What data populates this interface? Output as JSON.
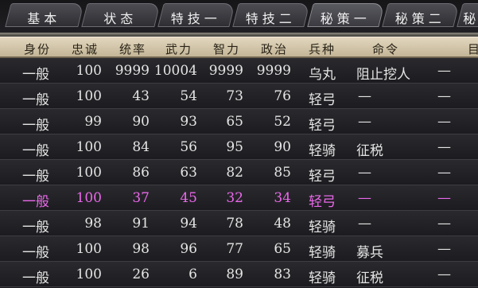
{
  "tabs": [
    "基本",
    "状态",
    "特技一",
    "特技二",
    "秘策一",
    "秘策二",
    "秘"
  ],
  "columns": [
    "身份",
    "忠诚",
    "统率",
    "武力",
    "智力",
    "政治",
    "兵种",
    "命令",
    "目"
  ],
  "rows": [
    {
      "identity": "一般",
      "loyalty": "100",
      "command": "9999",
      "force": "10004",
      "intel": "9999",
      "politics": "9999",
      "troop": "乌丸",
      "order": "阻止挖人",
      "target": "—"
    },
    {
      "identity": "一般",
      "loyalty": "100",
      "command": "43",
      "force": "54",
      "intel": "73",
      "politics": "76",
      "troop": "轻弓",
      "order": "—",
      "target": "—"
    },
    {
      "identity": "一般",
      "loyalty": "99",
      "command": "90",
      "force": "93",
      "intel": "65",
      "politics": "52",
      "troop": "轻弓",
      "order": "—",
      "target": "—"
    },
    {
      "identity": "一般",
      "loyalty": "100",
      "command": "84",
      "force": "56",
      "intel": "95",
      "politics": "90",
      "troop": "轻骑",
      "order": "征税",
      "target": "—"
    },
    {
      "identity": "一般",
      "loyalty": "100",
      "command": "86",
      "force": "63",
      "intel": "82",
      "politics": "85",
      "troop": "轻弓",
      "order": "—",
      "target": "—"
    },
    {
      "identity": "一般",
      "loyalty": "100",
      "command": "37",
      "force": "45",
      "intel": "32",
      "politics": "34",
      "troop": "轻弓",
      "order": "—",
      "target": "—"
    },
    {
      "identity": "一般",
      "loyalty": "98",
      "command": "91",
      "force": "94",
      "intel": "78",
      "politics": "48",
      "troop": "轻骑",
      "order": "—",
      "target": "—"
    },
    {
      "identity": "一般",
      "loyalty": "100",
      "command": "98",
      "force": "96",
      "intel": "77",
      "politics": "65",
      "troop": "轻骑",
      "order": "募兵",
      "target": "—"
    },
    {
      "identity": "一般",
      "loyalty": "100",
      "command": "26",
      "force": "6",
      "intel": "89",
      "politics": "83",
      "troop": "轻骑",
      "order": "征税",
      "target": "—"
    }
  ],
  "colors": {
    "highlight_row": "#ea68ea",
    "header_bg": "#d4c8ab",
    "row_bg": "#242428"
  }
}
